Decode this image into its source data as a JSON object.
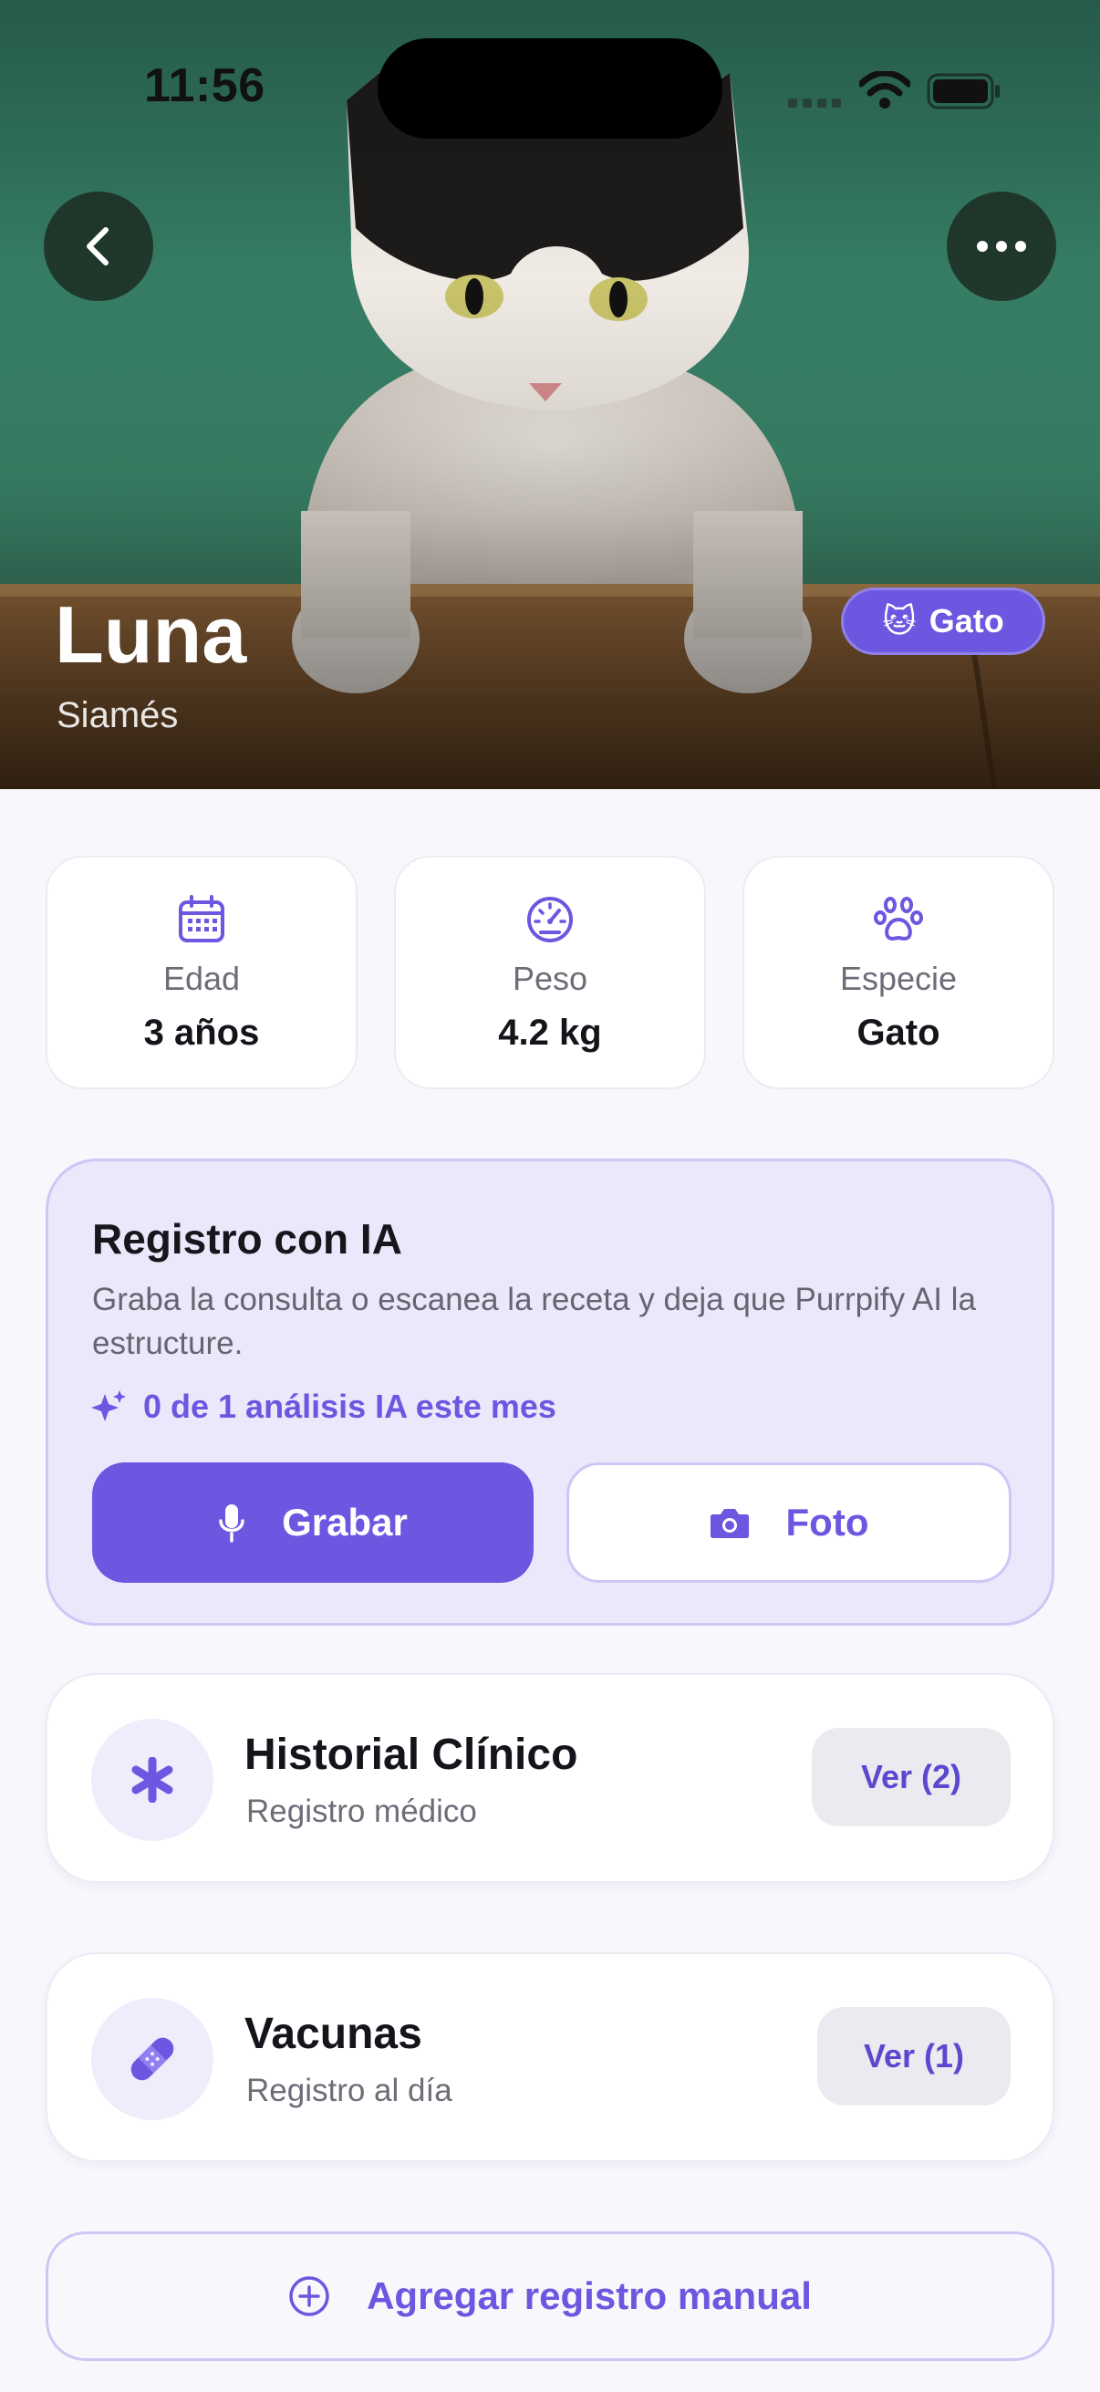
{
  "status_bar": {
    "time": "11:56"
  },
  "hero": {
    "name": "Luna",
    "breed": "Siamés",
    "badge_emoji": "🐱",
    "badge_label": "Gato"
  },
  "stats": [
    {
      "icon": "calendar-icon",
      "label": "Edad",
      "value": "3 años"
    },
    {
      "icon": "speedometer-icon",
      "label": "Peso",
      "value": "4.2 kg"
    },
    {
      "icon": "paw-icon",
      "label": "Especie",
      "value": "Gato"
    }
  ],
  "ai_card": {
    "title": "Registro con IA",
    "description": "Graba la consulta o escanea la receta y deja que Purrpify AI la estructure.",
    "quota": "0 de 1 análisis IA este mes",
    "record_label": "Grabar",
    "photo_label": "Foto"
  },
  "records": [
    {
      "icon": "asterisk-icon",
      "title": "Historial Clínico",
      "subtitle": "Registro médico",
      "action": "Ver (2)"
    },
    {
      "icon": "bandage-icon",
      "title": "Vacunas",
      "subtitle": "Registro al día",
      "action": "Ver (1)"
    }
  ],
  "manual_button": {
    "label": "Agregar registro manual"
  },
  "colors": {
    "accent": "#6b57e0",
    "accent_light": "#ece8fb",
    "background": "#f8f7fc"
  }
}
